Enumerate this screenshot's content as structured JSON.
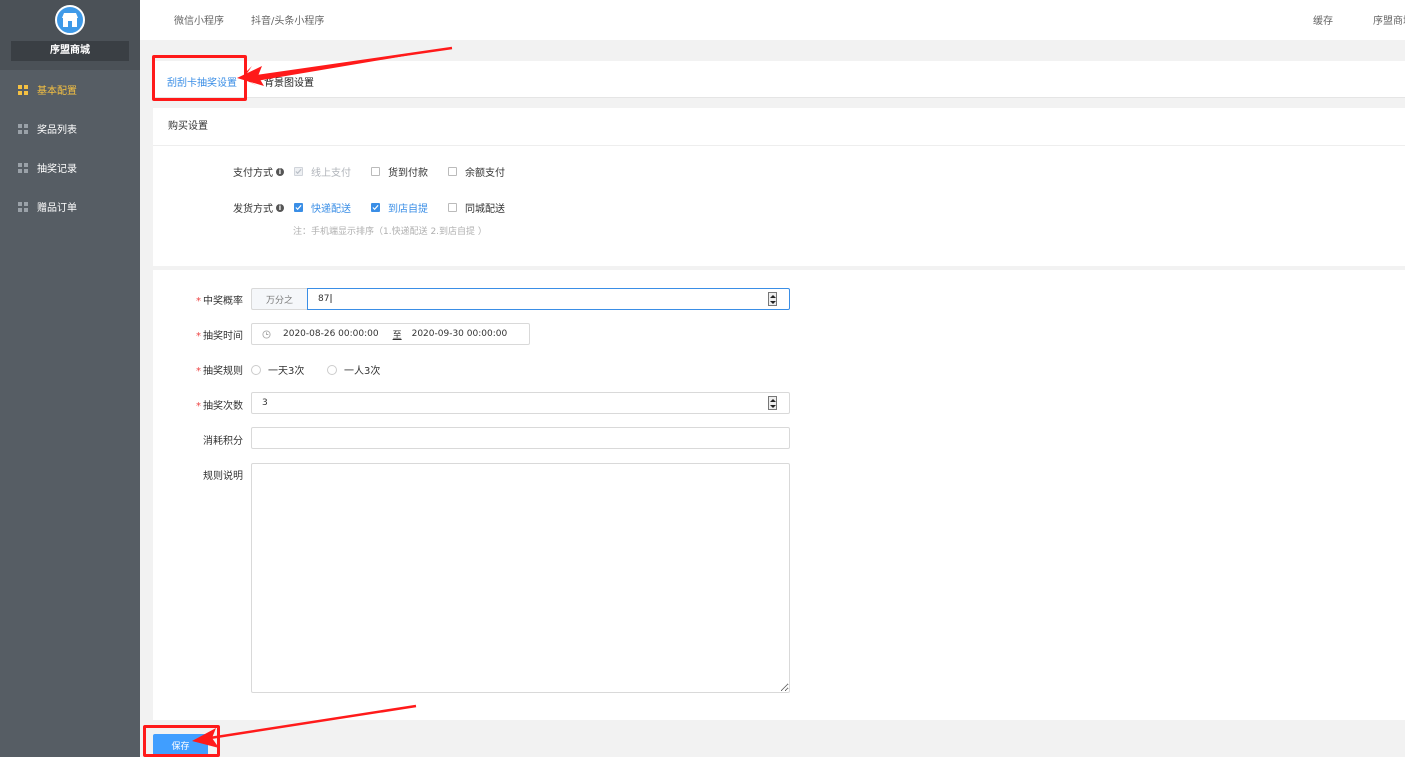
{
  "sidebar": {
    "shop_name": "序盟商城",
    "items": [
      {
        "label": "基本配置",
        "active": true
      },
      {
        "label": "奖品列表",
        "active": false
      },
      {
        "label": "抽奖记录",
        "active": false
      },
      {
        "label": "赠品订单",
        "active": false
      }
    ]
  },
  "topbar": {
    "links": [
      "微信小程序",
      "抖音/头条小程序"
    ],
    "right": [
      "缓存",
      "序盟商城"
    ]
  },
  "tabs": [
    "刮刮卡抽奖设置",
    "背景图设置"
  ],
  "purchase": {
    "title": "购买设置",
    "payment_label": "支付方式",
    "payment_options": [
      "线上支付",
      "货到付款",
      "余额支付"
    ],
    "delivery_label": "发货方式",
    "delivery_options": [
      "快递配送",
      "到店自提",
      "同城配送"
    ],
    "note": "注：手机端显示排序（1.快递配送 2.到店自提 ）"
  },
  "form": {
    "rate_label": "中奖概率",
    "rate_prefix": "万分之",
    "rate_value": "87",
    "time_label": "抽奖时间",
    "time_start": "2020-08-26 00:00:00",
    "time_sep": "至",
    "time_end": "2020-09-30 00:00:00",
    "rule_label": "抽奖规则",
    "rule_options": [
      "一天3次",
      "一人3次"
    ],
    "count_label": "抽奖次数",
    "count_value": "3",
    "points_label": "消耗积分",
    "points_value": "",
    "desc_label": "规则说明",
    "desc_value": ""
  },
  "save_label": "保存",
  "colors": {
    "accent": "#3a8ee6",
    "sidebar_bg": "#565d64",
    "active_nav": "#f5c142",
    "annotation": "#ff1a1a"
  }
}
